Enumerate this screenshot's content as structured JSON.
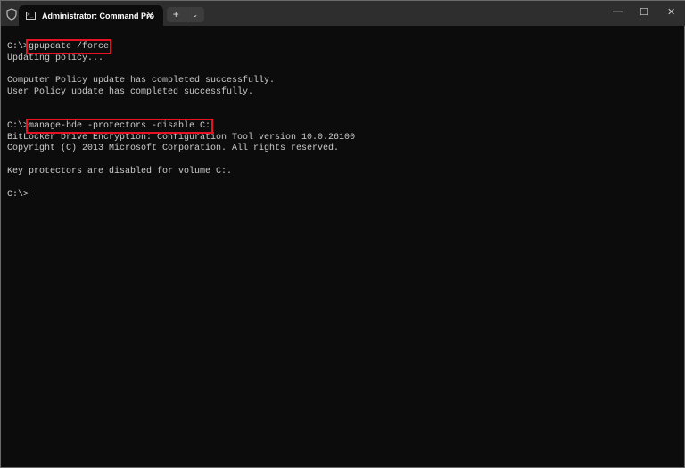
{
  "window": {
    "tab_title": "Administrator: Command Pro",
    "new_tab": "+",
    "dropdown": "⌄",
    "minimize": "—",
    "maximize": "☐",
    "close": "✕",
    "tab_close": "✕"
  },
  "terminal": {
    "prompt": "C:\\>",
    "cmd1": "gpupdate /force",
    "l2": "Updating policy...",
    "l3": "Computer Policy update has completed successfully.",
    "l4": "User Policy update has completed successfully.",
    "cmd2": "manage-bde -protectors -disable C:",
    "l6": "BitLocker Drive Encryption: Configuration Tool version 10.0.26100",
    "l7": "Copyright (C) 2013 Microsoft Corporation. All rights reserved.",
    "l8": "Key protectors are disabled for volume C:."
  }
}
